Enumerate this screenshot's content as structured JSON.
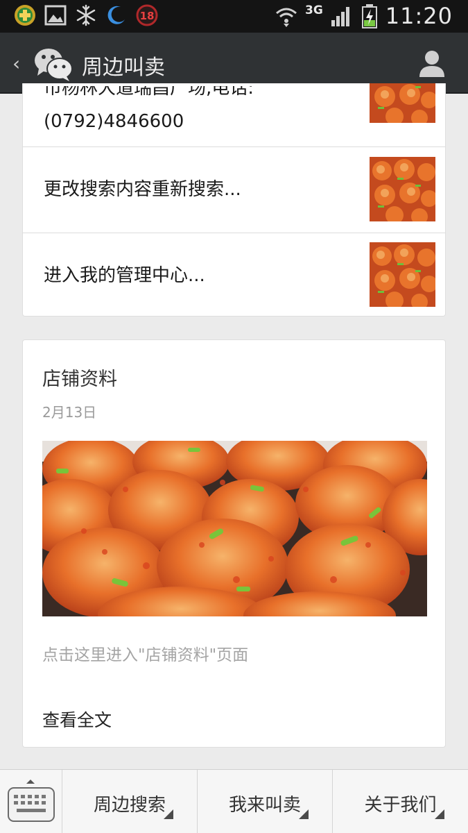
{
  "status_bar": {
    "notification_icons": [
      "wechat-plus-icon",
      "gallery-icon",
      "snowflake-icon",
      "moon-icon",
      "badge-18-icon"
    ],
    "badge_count": "18",
    "network": "3G",
    "time": "11:20"
  },
  "title_bar": {
    "title": "周边叫卖",
    "back_icon": "chevron-left-icon",
    "logo_icon": "wechat-logo-icon",
    "profile_icon": "person-icon"
  },
  "list": {
    "items": [
      {
        "text_line1": "市杨林大道瑞昌广场,电话:",
        "text_line2": "(0792)4846600"
      },
      {
        "text": "更改搜索内容重新搜索..."
      },
      {
        "text": "进入我的管理中心..."
      }
    ]
  },
  "article": {
    "title": "店铺资料",
    "date": "2月13日",
    "summary": "点击这里进入\"店铺资料\"页面",
    "read_more": "查看全文"
  },
  "bottom_menu": {
    "keyboard_icon": "keyboard-icon",
    "items": [
      {
        "label": "周边搜索"
      },
      {
        "label": "我来叫卖"
      },
      {
        "label": "关于我们"
      }
    ]
  },
  "colors": {
    "title_bar_bg": "#2f3234",
    "status_bar_bg": "#141414",
    "page_bg": "#ebebeb"
  }
}
